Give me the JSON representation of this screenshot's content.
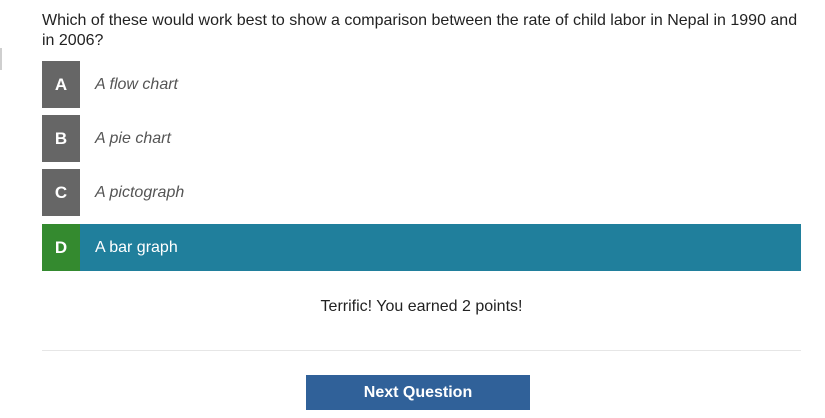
{
  "question": {
    "text": "Which of these would work best to show a comparison between the rate of child labor in Nepal in 1990 and in 2006?"
  },
  "options": [
    {
      "letter": "A",
      "label": "A flow chart",
      "state": "unselected"
    },
    {
      "letter": "B",
      "label": "A pie chart",
      "state": "unselected"
    },
    {
      "letter": "C",
      "label": "A pictograph",
      "state": "unselected"
    },
    {
      "letter": "D",
      "label": "A bar graph",
      "state": "correct-selected"
    }
  ],
  "feedback": {
    "text": "Terrific! You earned 2 points!"
  },
  "next_button": {
    "label": "Next Question"
  },
  "colors": {
    "letter_box_default": "#666666",
    "letter_box_correct": "#348a2f",
    "selected_row_background": "#207f9c",
    "next_button_background": "#306199",
    "question_text": "#222222",
    "option_text": "#555555"
  }
}
